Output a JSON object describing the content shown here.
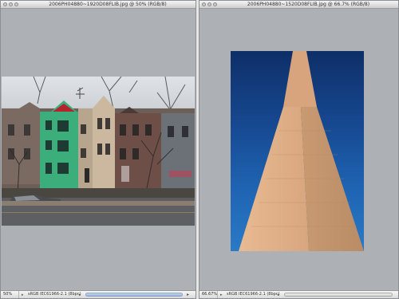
{
  "windows": {
    "left": {
      "title": "2006PH04880~1920D08FLIB.jpg @ 50% (RGB/8)",
      "zoom": "50%",
      "profile": "sRGB IEC61966-2.1 (8bpc)"
    },
    "right": {
      "title": "2006PH04880~1520D08FLIB.jpg @ 66.7% (RGB/8)",
      "zoom": "66.67%",
      "profile": "sRGB IEC61966-2.1 (8bpc)"
    }
  },
  "colors": {
    "canvas": "#adb1b6",
    "sky": "#16478f",
    "stone": "#d9a982",
    "green_house": "#39b07a",
    "scroll_blue": "#95b3d9"
  },
  "icons": [
    "close-icon",
    "minimize-icon",
    "zoom-icon",
    "info-menu-icon",
    "scroll-right-icon"
  ]
}
